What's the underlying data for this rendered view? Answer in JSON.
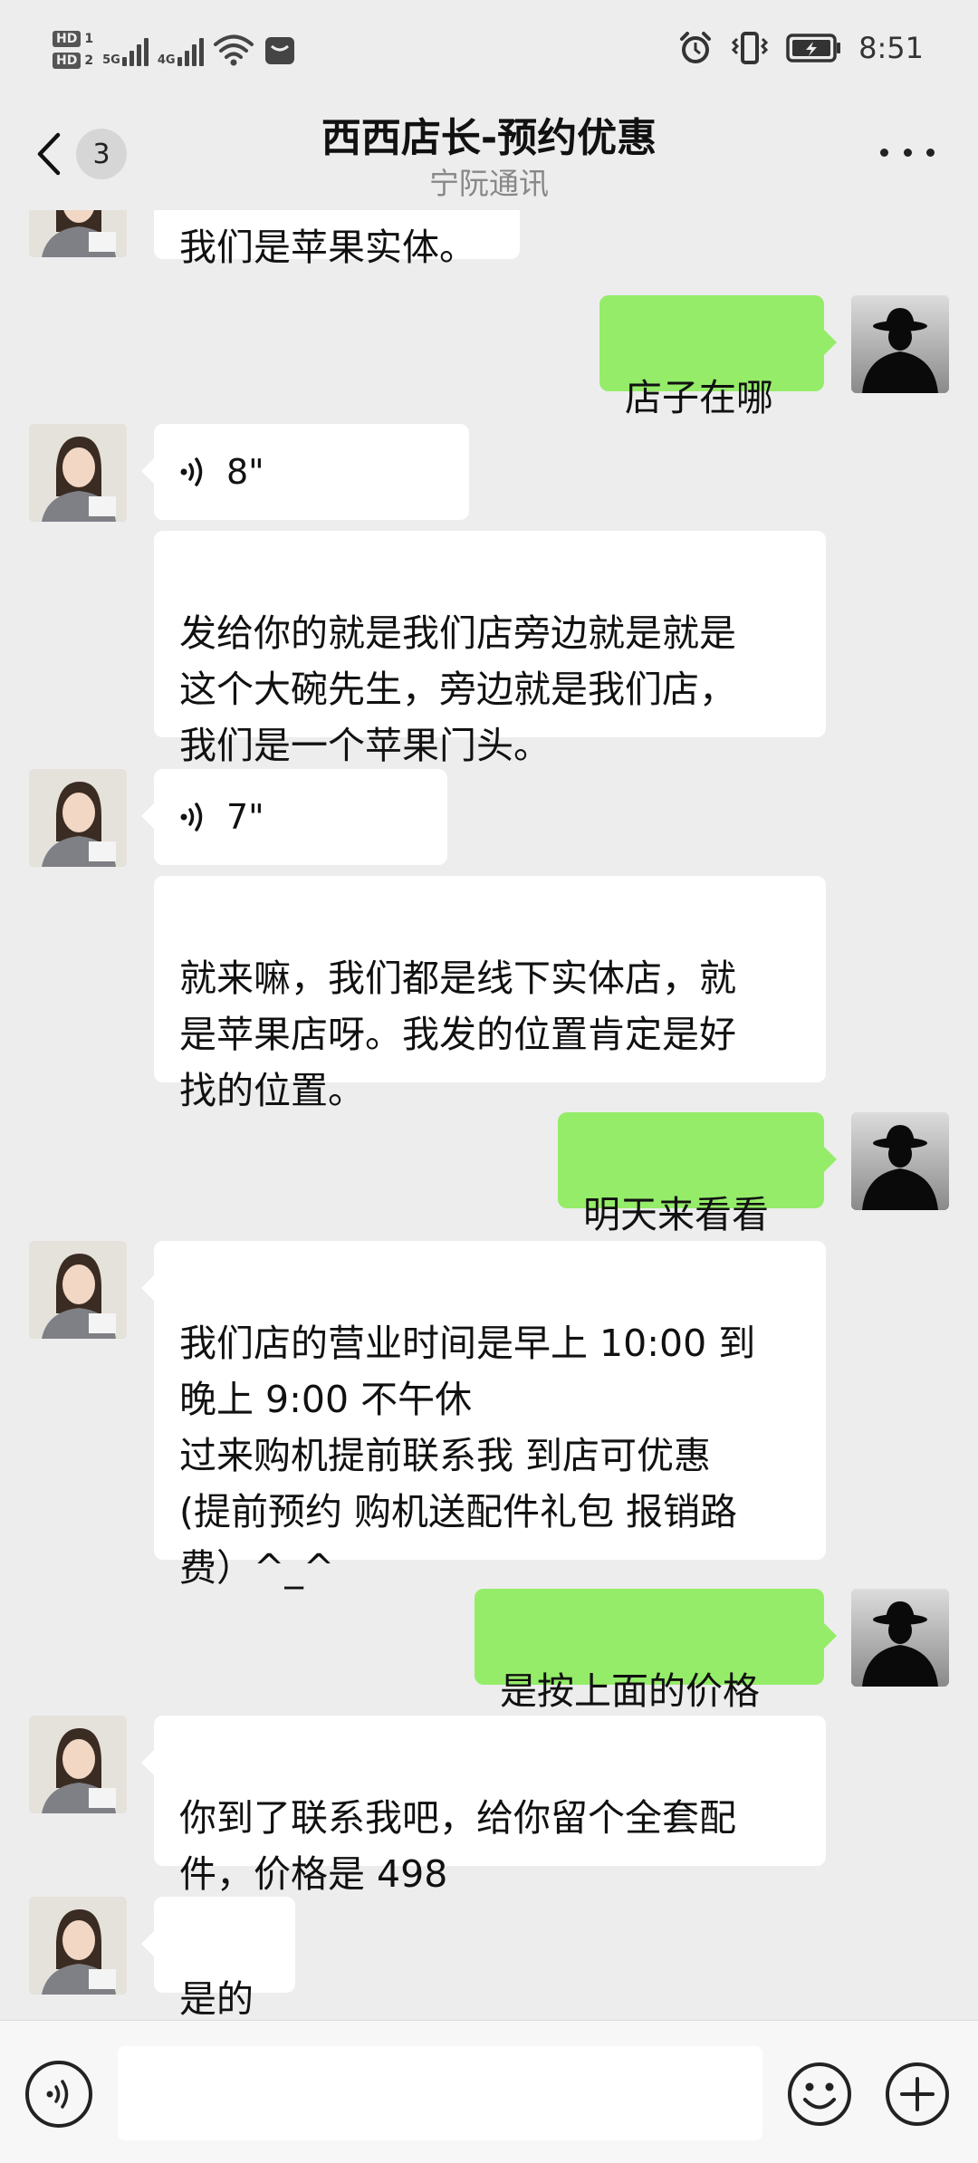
{
  "status_bar": {
    "hd1": "HD",
    "hd1_num": "1",
    "hd2": "HD",
    "hd2_num": "2",
    "net1": "5G",
    "net2": "4G",
    "time": "8:51"
  },
  "header": {
    "unread_count": "3",
    "title": "西西店长-预约优惠",
    "subtitle": "宁阮通讯"
  },
  "messages": [
    {
      "side": "left",
      "type": "text",
      "text": "我们是苹果实体。"
    },
    {
      "side": "right",
      "type": "text",
      "text": "店子在哪"
    },
    {
      "side": "left",
      "type": "voice",
      "duration": "8\""
    },
    {
      "side": "left",
      "type": "text",
      "text": "发给你的就是我们店旁边就是就是\n这个大碗先生，旁边就是我们店，\n我们是一个苹果门头。"
    },
    {
      "side": "left",
      "type": "voice",
      "duration": "7\""
    },
    {
      "side": "left",
      "type": "text",
      "text": "就来嘛，我们都是线下实体店，就\n是苹果店呀。我发的位置肯定是好\n找的位置。"
    },
    {
      "side": "right",
      "type": "text",
      "text": "明天来看看"
    },
    {
      "side": "left",
      "type": "text",
      "text": "我们店的营业时间是早上 10:00 到\n晚上 9:00 不午休\n过来购机提前联系我 到店可优惠\n(提前预约 购机送配件礼包 报销路\n费）^_^"
    },
    {
      "side": "right",
      "type": "text",
      "text": "是按上面的价格"
    },
    {
      "side": "left",
      "type": "text",
      "text": "你到了联系我吧，给你留个全套配\n件，价格是 498"
    },
    {
      "side": "left",
      "type": "text",
      "text": "是的"
    }
  ],
  "composer": {
    "placeholder": ""
  },
  "colors": {
    "background": "#ededed",
    "sent_bubble": "#95ec69",
    "received_bubble": "#ffffff"
  }
}
